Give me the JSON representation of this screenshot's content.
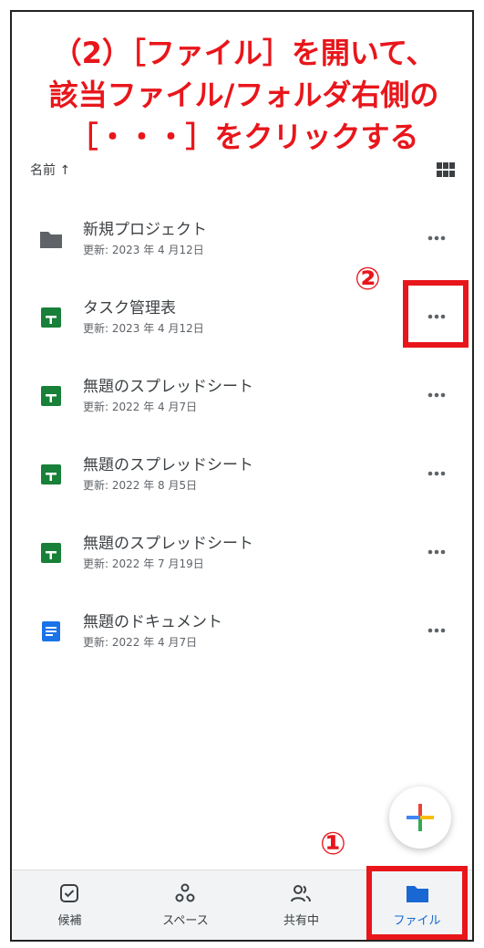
{
  "instruction": {
    "line1": "（2）［ファイル］を開いて、",
    "line2": "該当ファイル/フォルダ右側の",
    "line3": "［・・・］をクリックする",
    "color": "#e8161b"
  },
  "sort": {
    "label": "名前 ↑"
  },
  "files": [
    {
      "name": "新規プロジェクト",
      "modified": "更新: 2023 年 4 月12日",
      "icon": "folder-icon"
    },
    {
      "name": "タスク管理表",
      "modified": "更新: 2023 年 4 月12日",
      "icon": "sheets-icon"
    },
    {
      "name": "無題のスプレッドシート",
      "modified": "更新: 2022 年 4 月7日",
      "icon": "sheets-icon"
    },
    {
      "name": "無題のスプレッドシート",
      "modified": "更新: 2022 年 8 月5日",
      "icon": "sheets-icon"
    },
    {
      "name": "無題のスプレッドシート",
      "modified": "更新: 2022 年 7 月19日",
      "icon": "sheets-icon"
    },
    {
      "name": "無題のドキュメント",
      "modified": "更新: 2022 年 4 月7日",
      "icon": "docs-icon"
    }
  ],
  "annotations": {
    "step1": "①",
    "step2": "②"
  },
  "nav": {
    "items": [
      {
        "label": "候補",
        "icon": "check-square-icon"
      },
      {
        "label": "スペース",
        "icon": "spaces-icon"
      },
      {
        "label": "共有中",
        "icon": "people-icon"
      },
      {
        "label": "ファイル",
        "icon": "folder-icon"
      }
    ],
    "active": "ファイル",
    "accent": "#1967d2"
  }
}
